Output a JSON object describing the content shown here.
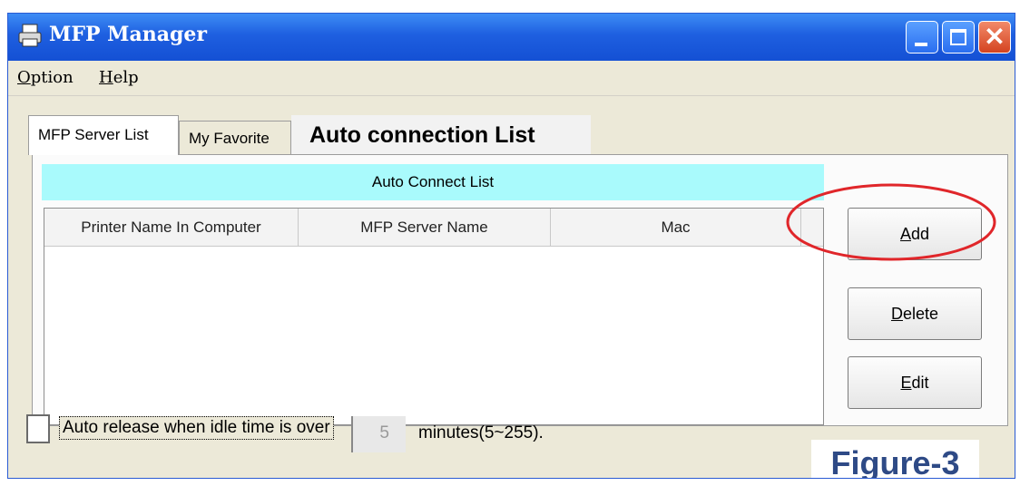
{
  "window": {
    "title": "MFP Manager",
    "close_glyph": "✕"
  },
  "menu": {
    "option": "Option",
    "help": "Help"
  },
  "tabs": {
    "server_list": "MFP Server List",
    "favorite": "My Favorite",
    "annotation": "Auto connection List"
  },
  "list": {
    "header": "Auto Connect List",
    "columns": [
      "Printer Name In Computer",
      "MFP Server Name",
      "Mac"
    ]
  },
  "buttons": {
    "add": "Add",
    "delete": "Delete",
    "edit": "Edit"
  },
  "idle": {
    "label": "Auto release when idle time is over",
    "value": "5",
    "unit": "minutes(5~255)."
  },
  "figure_label": "Figure-3",
  "colors": {
    "title_blue": "#1e5fe0",
    "list_header": "#a9fafc",
    "annotation_red": "#e0262a",
    "figure_text": "#2e4a86"
  },
  "icons": {
    "app": "printer-icon",
    "minimize": "minimize-icon",
    "maximize": "maximize-icon",
    "close": "close-icon"
  }
}
